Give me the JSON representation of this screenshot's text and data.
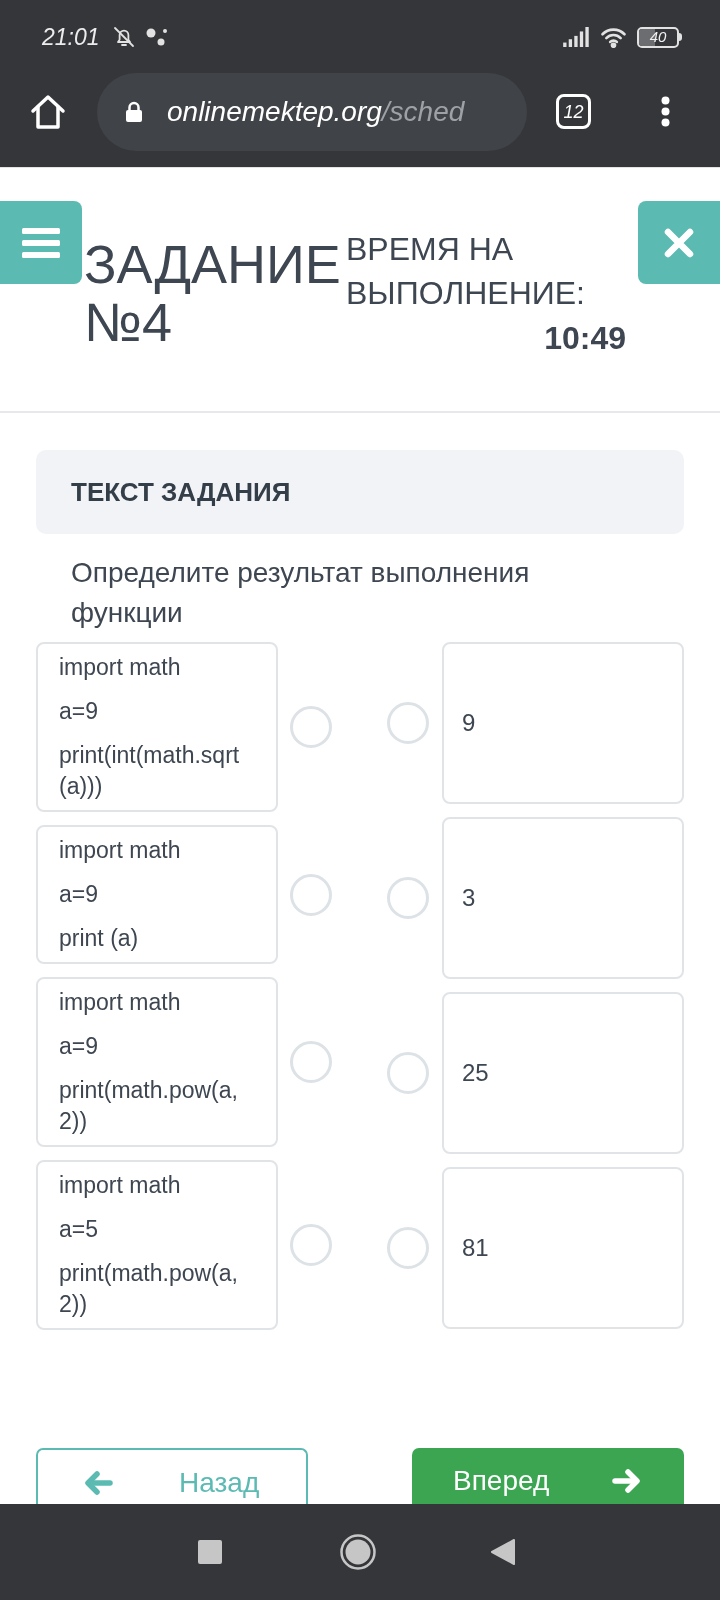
{
  "status_bar": {
    "time": "21:01",
    "battery": "40"
  },
  "browser": {
    "url_host": "onlinemektep.org",
    "url_path": "/sched",
    "tab_count": "12"
  },
  "header": {
    "title": "ЗАДАНИЕ №4",
    "timer_label": "ВРЕМЯ НА ВЫПОЛНЕНИЕ:",
    "timer": "10:49"
  },
  "task": {
    "heading": "ТЕКСТ ЗАДАНИЯ",
    "question": "Определите результат выполнения функции"
  },
  "left_items": [
    {
      "lines": [
        "import math",
        "a=9",
        "print(int(math.sqrt(a)))"
      ],
      "selected": false
    },
    {
      "lines": [
        "import math",
        "a=9",
        "print (a)"
      ],
      "selected": false
    },
    {
      "lines": [
        "import math",
        "a=9",
        "print(math.pow(a,2))"
      ],
      "selected": false
    },
    {
      "lines": [
        "import math",
        "a=5",
        "print(math.pow(a,2))"
      ],
      "selected": false
    }
  ],
  "right_items": [
    {
      "text": "9",
      "selected": false
    },
    {
      "text": "3",
      "selected": false
    },
    {
      "text": "25",
      "selected": false
    },
    {
      "text": "81",
      "selected": false
    }
  ],
  "nav_buttons": [
    {
      "kind": "back",
      "label": "Назад"
    },
    {
      "kind": "forward",
      "label": "Вперед"
    }
  ]
}
